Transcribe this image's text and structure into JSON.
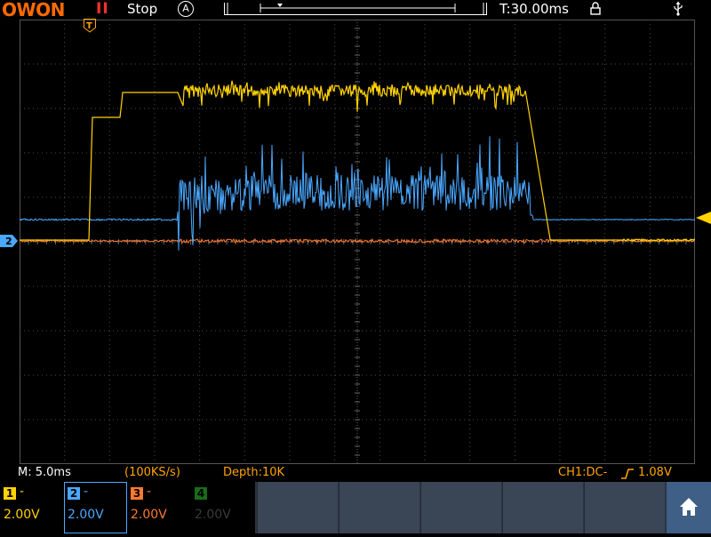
{
  "top": {
    "logo": "OWON",
    "run_indicator": "II",
    "run_state": "Stop",
    "trigger_mode": "A",
    "timebase": "T:30.00ms"
  },
  "status": {
    "main_timebase": "M: 5.0ms",
    "sample_rate": "(100KS/s)",
    "depth": "Depth:10K",
    "trigger_coupling": "CH1:DC-",
    "trigger_level": "1.08V"
  },
  "channels": [
    {
      "id": "1",
      "dash": "-",
      "volts": "2.00V",
      "color": "#ffd200",
      "active": true
    },
    {
      "id": "2",
      "dash": "-",
      "volts": "2.00V",
      "color": "#4aa8ff",
      "active": true,
      "selected": true
    },
    {
      "id": "3",
      "dash": "-",
      "volts": "2.00V",
      "color": "#ff7a30",
      "active": true
    },
    {
      "id": "4",
      "dash": "-",
      "volts": "2.00V",
      "color": "#33cc33",
      "active": false
    }
  ],
  "markers": {
    "ch2": "2",
    "trigger": "T"
  },
  "icons": {
    "home": "home-icon",
    "lock": "lock-icon",
    "usb": "usb-icon"
  },
  "colors": {
    "ch1": "#ffd200",
    "ch2": "#4aa8ff",
    "ch3": "#ff7a30",
    "ch4": "#33cc33",
    "grid": "#3a3a3a"
  }
}
